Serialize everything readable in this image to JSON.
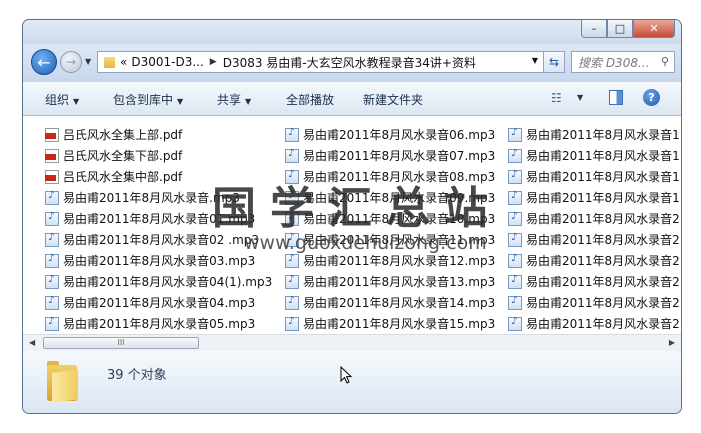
{
  "window": {
    "controls": {
      "minimize": "–",
      "maximize": "□",
      "close": "✕"
    }
  },
  "nav": {
    "back_glyph": "←",
    "forward_glyph": "→",
    "address": {
      "overflow": "«",
      "crumbs": [
        "D3001-D3...",
        "D3083 易由甫-大玄空风水教程录音34讲+资料"
      ]
    },
    "search_placeholder": "搜索 D308..."
  },
  "toolbar": {
    "organize": "组织",
    "include_in_library": "包含到库中",
    "share": "共享",
    "play_all": "全部播放",
    "new_folder": "新建文件夹"
  },
  "files": {
    "column1": [
      {
        "name": "吕氏风水全集上部.pdf",
        "type": "pdf"
      },
      {
        "name": "吕氏风水全集下部.pdf",
        "type": "pdf"
      },
      {
        "name": "吕氏风水全集中部.pdf",
        "type": "pdf"
      },
      {
        "name": "易由甫2011年8月风水录音.mp3",
        "type": "mp3"
      },
      {
        "name": "易由甫2011年8月风水录音01.mp3",
        "type": "mp3"
      },
      {
        "name": "易由甫2011年8月风水录音02 .mp3",
        "type": "mp3"
      },
      {
        "name": "易由甫2011年8月风水录音03.mp3",
        "type": "mp3"
      },
      {
        "name": "易由甫2011年8月风水录音04(1).mp3",
        "type": "mp3"
      },
      {
        "name": "易由甫2011年8月风水录音04.mp3",
        "type": "mp3"
      },
      {
        "name": "易由甫2011年8月风水录音05.mp3",
        "type": "mp3"
      }
    ],
    "column2": [
      {
        "name": "易由甫2011年8月风水录音06.mp3",
        "type": "mp3"
      },
      {
        "name": "易由甫2011年8月风水录音07.mp3",
        "type": "mp3"
      },
      {
        "name": "易由甫2011年8月风水录音08.mp3",
        "type": "mp3"
      },
      {
        "name": "易由甫2011年8月风水录音09.mp3",
        "type": "mp3"
      },
      {
        "name": "易由甫2011年8月风水录音10.mp3",
        "type": "mp3"
      },
      {
        "name": "易由甫2011年8月风水录音11.mp3",
        "type": "mp3"
      },
      {
        "name": "易由甫2011年8月风水录音12.mp3",
        "type": "mp3"
      },
      {
        "name": "易由甫2011年8月风水录音13.mp3",
        "type": "mp3"
      },
      {
        "name": "易由甫2011年8月风水录音14.mp3",
        "type": "mp3"
      },
      {
        "name": "易由甫2011年8月风水录音15.mp3",
        "type": "mp3"
      }
    ],
    "column3": [
      {
        "name": "易由甫2011年8月风水录音1",
        "type": "mp3"
      },
      {
        "name": "易由甫2011年8月风水录音1",
        "type": "mp3"
      },
      {
        "name": "易由甫2011年8月风水录音1",
        "type": "mp3"
      },
      {
        "name": "易由甫2011年8月风水录音1",
        "type": "mp3"
      },
      {
        "name": "易由甫2011年8月风水录音2",
        "type": "mp3"
      },
      {
        "name": "易由甫2011年8月风水录音2",
        "type": "mp3"
      },
      {
        "name": "易由甫2011年8月风水录音2",
        "type": "mp3"
      },
      {
        "name": "易由甫2011年8月风水录音2",
        "type": "mp3"
      },
      {
        "name": "易由甫2011年8月风水录音2",
        "type": "mp3"
      },
      {
        "name": "易由甫2011年8月风水录音2",
        "type": "mp3"
      }
    ]
  },
  "scrollbar": {
    "left": "◀",
    "right": "▶",
    "thumb": "III"
  },
  "details": {
    "count": "39 个对象"
  },
  "watermark": {
    "text": "国学汇总站",
    "url": "www.guoxdehuizong.com"
  }
}
